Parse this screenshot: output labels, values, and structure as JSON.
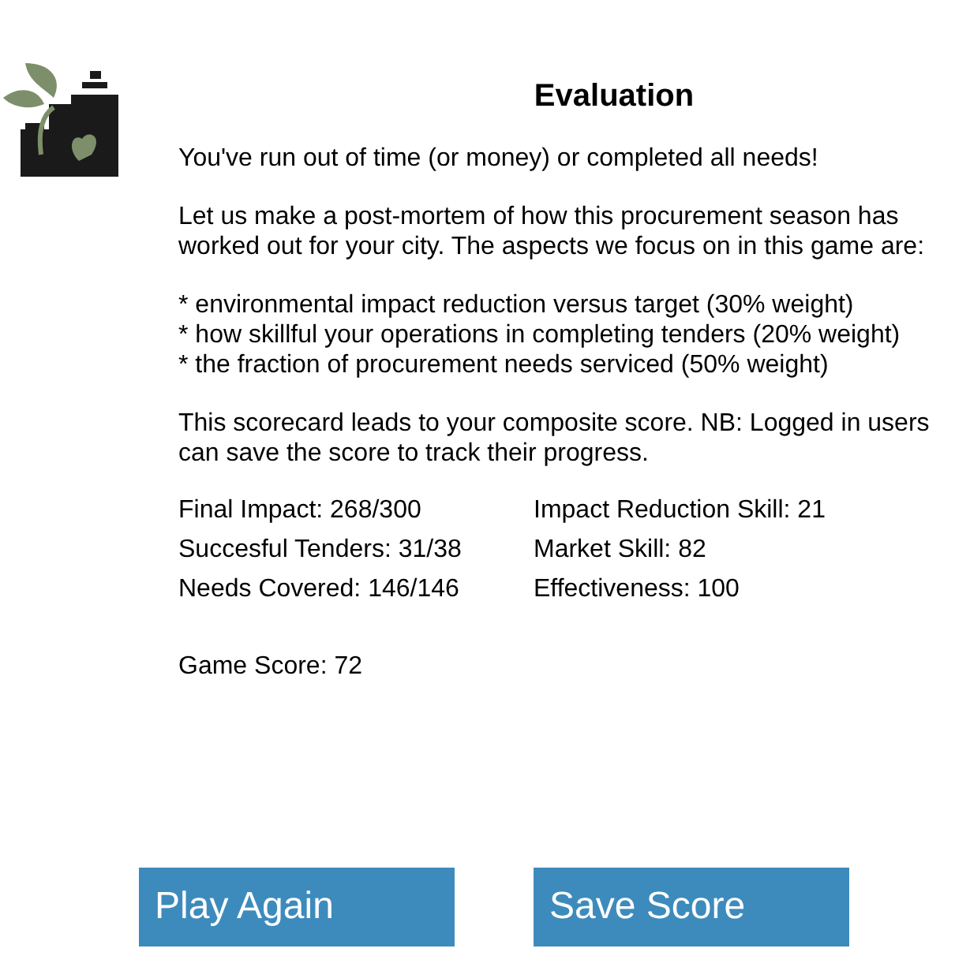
{
  "title": "Evaluation",
  "paragraphs": [
    "You've run out of time (or money) or completed all needs!",
    "Let us make a post-mortem of how this procurement season has worked out for your city. The aspects we focus on in this game are:",
    "* environmental impact reduction versus target (30% weight)\n* how skillful your operations in completing tenders (20% weight)\n* the fraction of procurement needs serviced (50% weight)",
    "This scorecard leads to your composite score. NB: Logged in users can save the score to track their progress."
  ],
  "stats": [
    [
      "Final Impact: 268/300",
      "Impact Reduction Skill: 21"
    ],
    [
      "Succesful Tenders: 31/38",
      "Market Skill: 82"
    ],
    [
      "Needs Covered: 146/146",
      "Effectiveness: 100"
    ]
  ],
  "score": "Game Score: 72",
  "buttons": [
    "Play Again",
    "Save Score"
  ]
}
